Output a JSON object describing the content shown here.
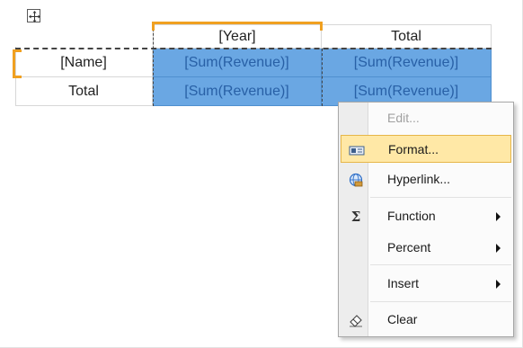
{
  "grid": {
    "header_row": [
      "",
      "[Year]",
      "Total"
    ],
    "rows": [
      [
        "[Name]",
        "[Sum(Revenue)]",
        "[Sum(Revenue)]"
      ],
      [
        "Total",
        "[Sum(Revenue)]",
        "[Sum(Revenue)]"
      ]
    ]
  },
  "context_menu": {
    "items": [
      {
        "label": "Edit...",
        "icon": "none",
        "enabled": false
      },
      {
        "label": "Format...",
        "icon": "format-icon",
        "enabled": true,
        "highlighted": true
      },
      {
        "label": "Hyperlink...",
        "icon": "hyperlink-globe-icon",
        "enabled": true
      },
      {
        "label": "Function",
        "icon": "sigma-icon",
        "enabled": true,
        "submenu": true
      },
      {
        "label": "Percent",
        "icon": "none",
        "enabled": true,
        "submenu": true
      },
      {
        "label": "Insert",
        "icon": "none",
        "enabled": true,
        "submenu": true
      },
      {
        "label": "Clear",
        "icon": "eraser-icon",
        "enabled": true
      }
    ]
  },
  "colors": {
    "selection": "#6aa7e3",
    "selection_text": "#2860a6",
    "accent_orange": "#f0a020",
    "menu_highlight": "#ffe8a6"
  }
}
